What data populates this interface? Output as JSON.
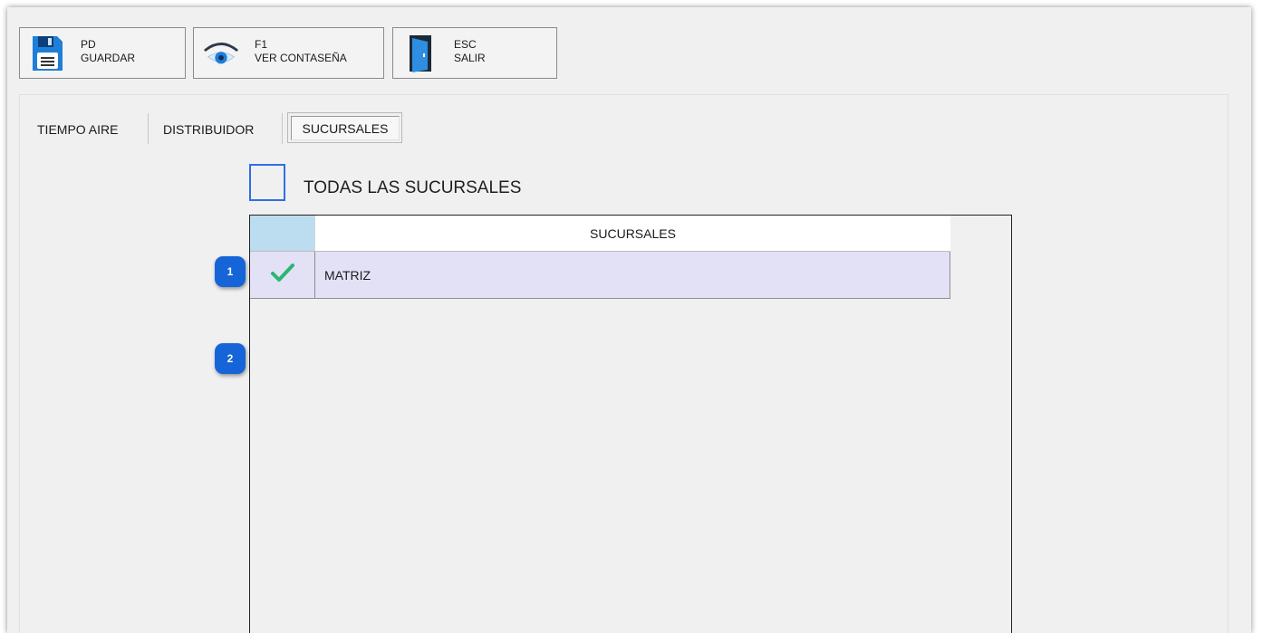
{
  "toolbar": {
    "buttons": [
      {
        "key": "PD",
        "label": "GUARDAR",
        "icon": "floppy-disk-icon"
      },
      {
        "key": "F1",
        "label": "VER CONTASEÑA",
        "icon": "eye-icon"
      },
      {
        "key": "ESC",
        "label": "SALIR",
        "icon": "exit-door-icon"
      }
    ]
  },
  "tabs": [
    {
      "label": "TIEMPO AIRE",
      "active": false
    },
    {
      "label": "DISTRIBUIDOR",
      "active": false
    },
    {
      "label": "SUCURSALES",
      "active": true
    }
  ],
  "callouts": [
    "1",
    "2"
  ],
  "select_all": {
    "label": "TODAS LAS SUCURSALES",
    "checked": false
  },
  "grid": {
    "column_header": "SUCURSALES",
    "rows": [
      {
        "name": "MATRIZ",
        "checked": true
      }
    ]
  },
  "colors": {
    "badge": "#1565d8",
    "checkbox_border": "#2f6fe6",
    "row_selected": "#e3e1f6",
    "header_corner": "#bcdcf0",
    "checkmark": "#2bb673"
  }
}
